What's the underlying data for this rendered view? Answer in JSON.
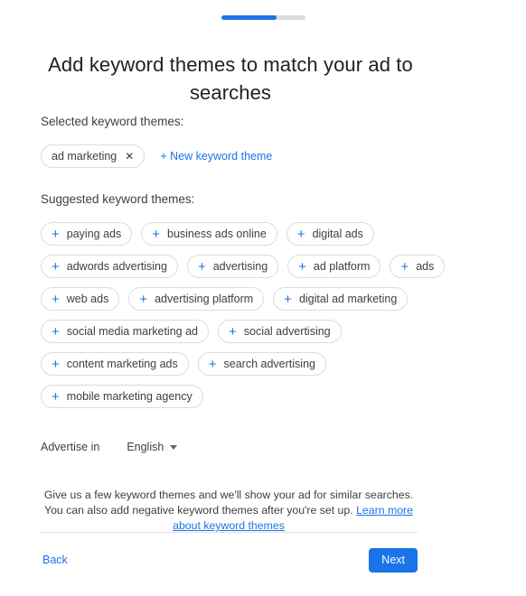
{
  "progress": {
    "percent": 66,
    "fill_color": "#1a73e8",
    "track_color": "#dadce0"
  },
  "header": {
    "title": "Add keyword themes to match your ad to searches"
  },
  "selected_section": {
    "label": "Selected keyword themes:",
    "chips": [
      {
        "label": "ad marketing",
        "close_icon": "close-icon"
      }
    ],
    "new_theme_link": "+ New keyword theme"
  },
  "suggested_section": {
    "label": "Suggested keyword themes:",
    "rows": [
      [
        "paying ads",
        "business ads online",
        "digital ads"
      ],
      [
        "adwords advertising",
        "advertising",
        "ad platform",
        "ads"
      ],
      [
        "web ads",
        "advertising platform",
        "digital ad marketing"
      ],
      [
        "social media marketing ad",
        "social advertising"
      ],
      [
        "content marketing ads",
        "search advertising"
      ],
      [
        "mobile marketing agency"
      ]
    ],
    "add_icon": "+"
  },
  "advertise": {
    "label": "Advertise in",
    "language": "English",
    "caret_icon": "chevron-down-icon"
  },
  "help": {
    "text_before": "Give us a few keyword themes and we'll show your ad for similar searches. You can also add negative keyword themes after you're set up. ",
    "link_text": "Learn more about keyword themes"
  },
  "footer": {
    "back_label": "Back",
    "next_label": "Next",
    "accent_color": "#1a73e8"
  }
}
